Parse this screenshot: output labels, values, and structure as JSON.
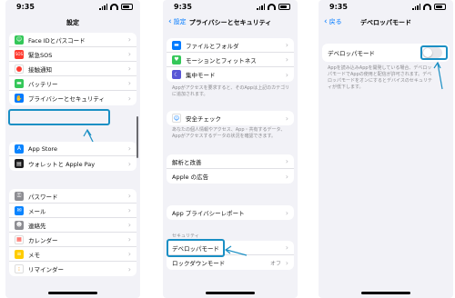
{
  "status": {
    "time": "9:35"
  },
  "phone1": {
    "title": "設定",
    "group_a": [
      {
        "label": "Face IDとパスコード",
        "icon": "faceid-icon",
        "color": "#34c759"
      },
      {
        "label": "緊急SOS",
        "icon": "sos-icon",
        "color": "#ff3b30"
      },
      {
        "label": "接触通知",
        "icon": "exposure-icon",
        "color": "#ff3b30"
      },
      {
        "label": "バッテリー",
        "icon": "battery-icon",
        "color": "#34c759"
      },
      {
        "label": "プライバシーとセキュリティ",
        "icon": "privacy-hand-icon",
        "color": "#007aff"
      }
    ],
    "group_b": [
      {
        "label": "App Store",
        "icon": "appstore-icon",
        "color": "#0a84ff"
      },
      {
        "label": "ウォレットと Apple Pay",
        "icon": "wallet-icon",
        "color": "#1c1c1e"
      }
    ],
    "group_c": [
      {
        "label": "パスワード",
        "icon": "key-icon",
        "color": "#8e8e93"
      },
      {
        "label": "メール",
        "icon": "mail-icon",
        "color": "#0a84ff"
      },
      {
        "label": "連絡先",
        "icon": "contacts-icon",
        "color": "#8e8e93"
      },
      {
        "label": "カレンダー",
        "icon": "calendar-icon",
        "color": "#ff3b30"
      },
      {
        "label": "メモ",
        "icon": "notes-icon",
        "color": "#ffcc00"
      },
      {
        "label": "リマインダー",
        "icon": "reminders-icon",
        "color": "#ff9500"
      }
    ]
  },
  "phone2": {
    "back_label": "設定",
    "title": "プライバシーとセキュリティ",
    "group_a": [
      {
        "label": "ファイルとフォルダ",
        "icon": "folder-icon",
        "color": "#007aff"
      },
      {
        "label": "モーションとフィットネス",
        "icon": "fitness-icon",
        "color": "#34c759"
      },
      {
        "label": "集中モード",
        "icon": "focus-icon",
        "color": "#5856d6"
      }
    ],
    "note_a": "Appがアクセスを要求すると、そのAppは上記のカテゴリに追加されます。",
    "safety_check": "安全チェック",
    "note_b": "あなたの個人情報やアクセス、App・共有するデータ、 Appがアクセスするデータの状況を確認できます。",
    "analytics": "解析と改善",
    "apple_ads": "Apple の広告",
    "app_report": "App プライバシーレポート",
    "section_security": "セキュリティ",
    "developer_mode": "デベロッパモード",
    "lockdown_mode": "ロックダウンモード",
    "lockdown_value": "オフ"
  },
  "phone3": {
    "back_label": "戻る",
    "title": "デベロッパモード",
    "toggle_label": "デベロッパモード",
    "toggle_on": false,
    "description": "Appを読み込みAppを開発している場合、デベロッパモードでAppの使用と配信が許可されます。デベロッパモードをオンにするとデバイスのセキュリティが低下します。"
  }
}
